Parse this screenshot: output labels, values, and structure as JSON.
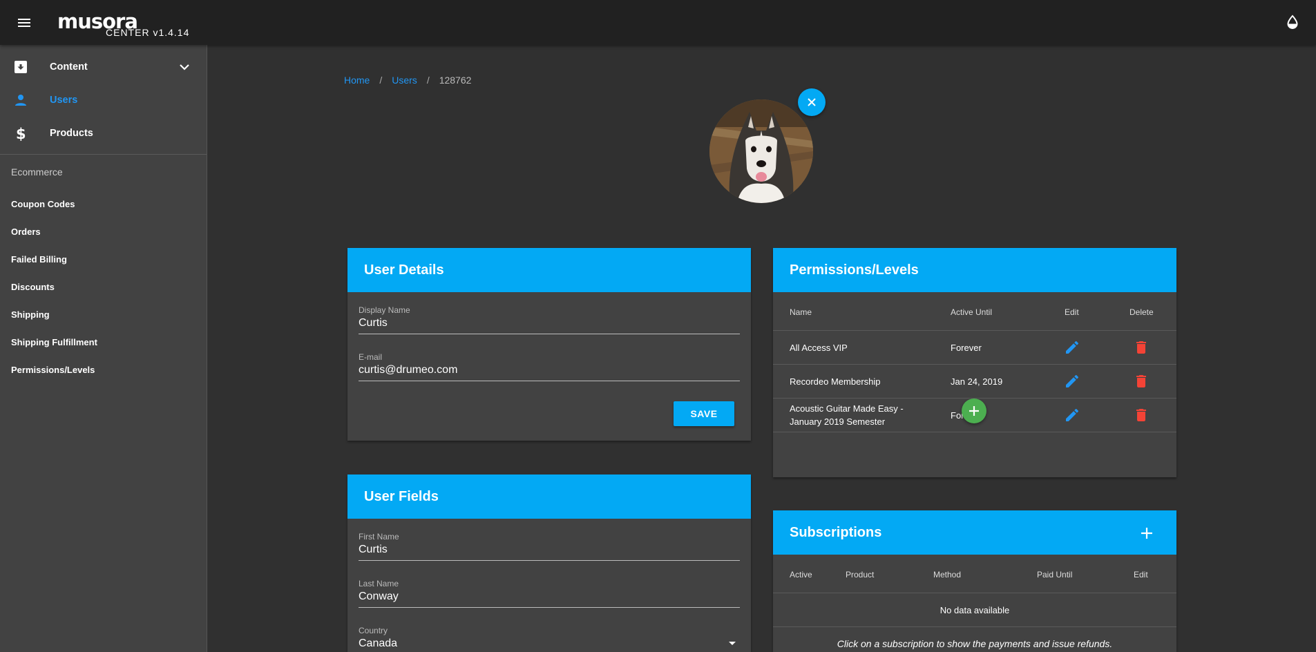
{
  "header": {
    "logo": "musora",
    "logo_sub": "CENTER",
    "version": "v1.4.14",
    "menu_icon": "hamburger-icon",
    "theme_icon": "invert-colors-icon"
  },
  "sidebar": {
    "nav": [
      {
        "label": "Content",
        "icon": "archive-icon",
        "expandable": true
      },
      {
        "label": "Users",
        "icon": "person-icon",
        "active": true
      },
      {
        "label": "Products",
        "icon": "dollar-icon"
      }
    ],
    "section_title": "Ecommerce",
    "links": [
      "Coupon Codes",
      "Orders",
      "Failed Billing",
      "Discounts",
      "Shipping",
      "Shipping Fulfillment",
      "Permissions/Levels"
    ]
  },
  "breadcrumb": {
    "home": "Home",
    "users": "Users",
    "current": "128762"
  },
  "user_details": {
    "title": "User Details",
    "display_name_label": "Display Name",
    "display_name": "Curtis",
    "email_label": "E-mail",
    "email": "curtis@drumeo.com",
    "save_label": "SAVE"
  },
  "user_fields": {
    "title": "User Fields",
    "first_name_label": "First Name",
    "first_name": "Curtis",
    "last_name_label": "Last Name",
    "last_name": "Conway",
    "country_label": "Country",
    "country": "Canada"
  },
  "permissions": {
    "title": "Permissions/Levels",
    "headers": {
      "name": "Name",
      "active_until": "Active Until",
      "edit": "Edit",
      "delete": "Delete"
    },
    "rows": [
      {
        "name": "All Access VIP",
        "active_until": "Forever"
      },
      {
        "name": "Recordeo Membership",
        "active_until": "Jan 24, 2019"
      },
      {
        "name_line1": "Acoustic Guitar Made Easy -",
        "name_line2": "January 2019 Semester",
        "active_until": "Forever"
      }
    ]
  },
  "subscriptions": {
    "title": "Subscriptions",
    "headers": {
      "active": "Active",
      "product": "Product",
      "method": "Method",
      "paid_until": "Paid Until",
      "edit": "Edit"
    },
    "empty": "No data available",
    "hint": "Click on a subscription to show the payments and issue refunds."
  },
  "colors": {
    "accent": "#03a9f4",
    "link": "#2196f3",
    "delete": "#f44336",
    "add": "#4caf50"
  }
}
